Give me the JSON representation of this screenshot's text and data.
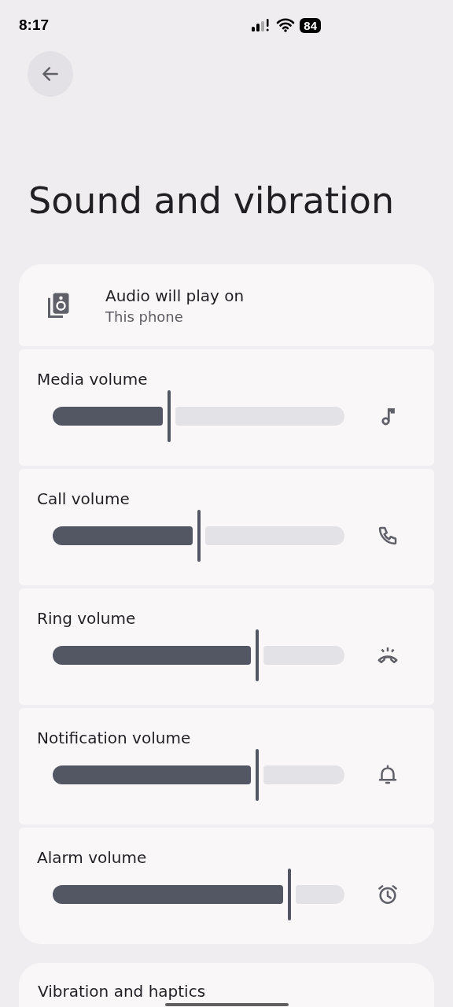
{
  "status_bar": {
    "time": "8:17",
    "battery": "84"
  },
  "title": "Sound and vibration",
  "output": {
    "label": "Audio will play on",
    "value": "This phone"
  },
  "sliders": [
    {
      "label": "Media volume",
      "level": 0.4
    },
    {
      "label": "Call volume",
      "level": 0.5
    },
    {
      "label": "Ring volume",
      "level": 0.7
    },
    {
      "label": "Notification volume",
      "level": 0.7
    },
    {
      "label": "Alarm volume",
      "level": 0.81
    }
  ],
  "next_section": {
    "label": "Vibration and haptics"
  }
}
